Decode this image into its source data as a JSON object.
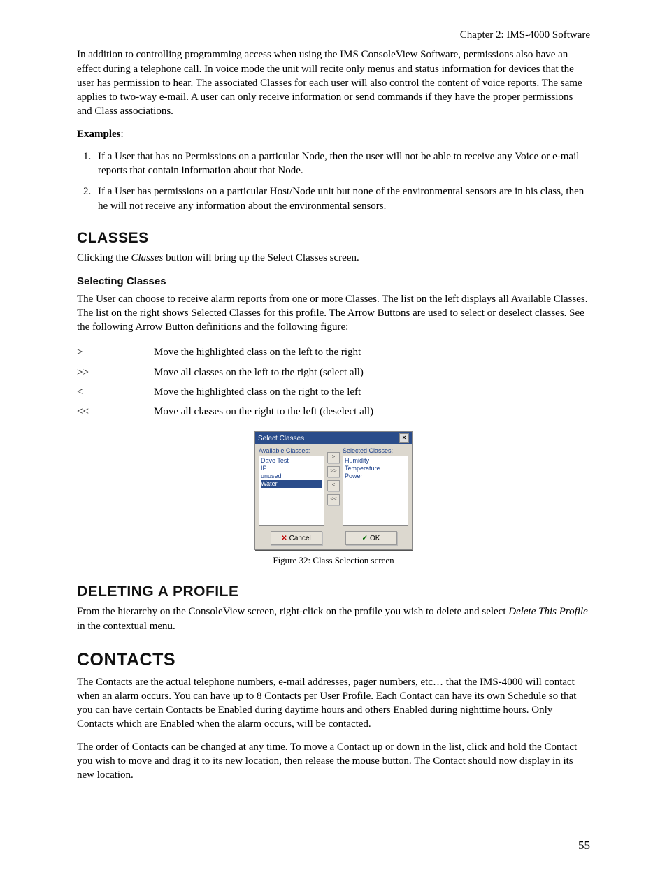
{
  "header": {
    "chapter": "Chapter 2: IMS-4000 Software"
  },
  "intro": {
    "p1": "In addition to controlling programming access when using the IMS ConsoleView Software, permissions also have an effect during a telephone call. In voice mode the unit will recite only menus and status information for devices that the user has permission to hear. The associated Classes for each user will also control the content of voice reports. The same applies to two-way e-mail. A user can only receive information or send commands if they have the proper permissions and Class associations.",
    "examples_label": "Examples",
    "ex1": "If a User that has no Permissions on a particular Node, then the user will not be able to receive any Voice or e-mail reports that contain information about that Node.",
    "ex2": "If a User has permissions on a particular Host/Node unit but none of the environmental sensors are in his class, then he will not receive any information about the environmental sensors."
  },
  "classes": {
    "heading": "Classes",
    "p1a": "Clicking the ",
    "p1b": "Classes",
    "p1c": " button will bring up the Select Classes screen.",
    "sub_heading": "Selecting Classes",
    "p2": "The User can choose to receive alarm reports from one or more Classes. The list on the left displays all Available Classes. The list on the right shows Selected Classes for this profile. The Arrow Buttons are used to select or deselect classes. See the following Arrow Button definitions and the following figure:",
    "arrows": [
      {
        "sym": ">",
        "desc": "Move the highlighted class on the left to the right"
      },
      {
        "sym": ">>",
        "desc": "Move all classes on the left to the right (select all)"
      },
      {
        "sym": "<",
        "desc": "Move the highlighted class on the right to the left"
      },
      {
        "sym": "<<",
        "desc": "Move all classes on the right to the left (deselect all)"
      }
    ]
  },
  "dialog": {
    "title": "Select Classes",
    "avail_label": "Available Classes:",
    "sel_label": "Selected Classes:",
    "available": [
      "Dave Test",
      "IP",
      "unused",
      "Water"
    ],
    "avail_selected_index": 3,
    "selected": [
      "Humidity",
      "Temperature",
      "Power"
    ],
    "btn_add": ">",
    "btn_add_all": ">>",
    "btn_rem": "<",
    "btn_rem_all": "<<",
    "cancel": "Cancel",
    "ok": "OK"
  },
  "figure_caption": "Figure 32: Class Selection screen",
  "deleting": {
    "heading": "Deleting a Profile",
    "p1a": "From the hierarchy on the ConsoleView screen, right-click on the profile you wish to delete and select ",
    "p1b": "Delete This Profile",
    "p1c": " in the contextual menu."
  },
  "contacts": {
    "heading": "Contacts",
    "p1": "The Contacts are the actual telephone numbers, e-mail addresses, pager numbers, etc… that the IMS-4000 will contact when an alarm occurs. You can have up to 8 Contacts per User Profile. Each Contact can have its own Schedule so that you can have certain Contacts be Enabled during daytime hours and others Enabled during nighttime hours. Only Contacts which are Enabled when the alarm occurs, will be contacted.",
    "p2": "The order of Contacts can be changed at any time. To move a Contact up or down in the list, click and hold the Contact you wish to move and drag it to its new location, then release the mouse button. The Contact should now display in its new location."
  },
  "page_number": "55"
}
